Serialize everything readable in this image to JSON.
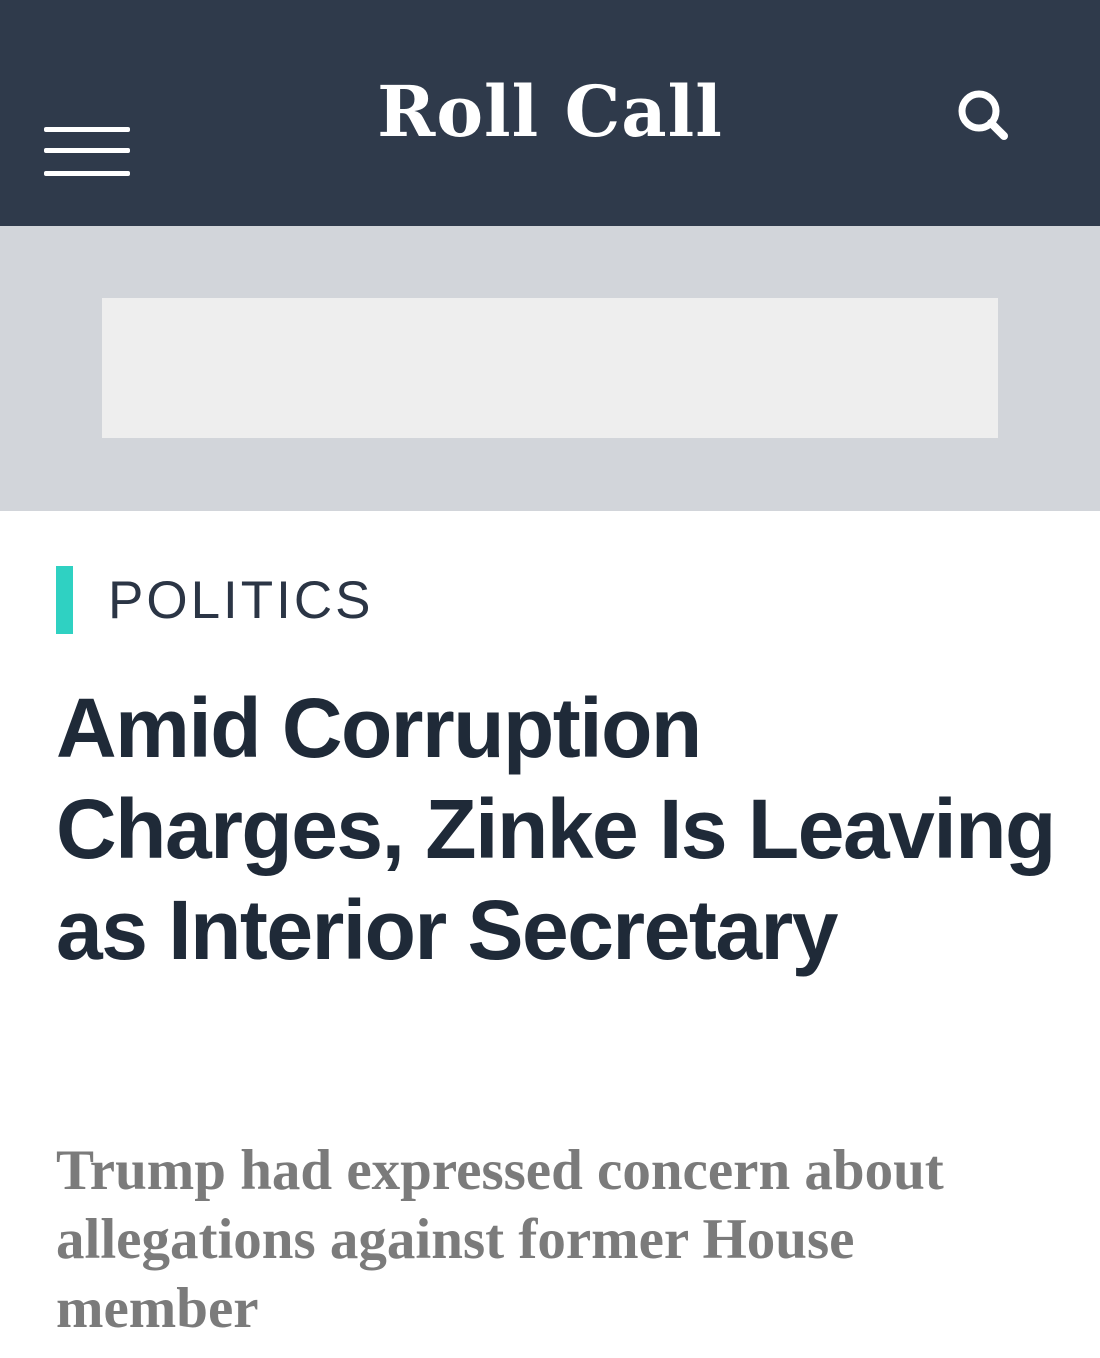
{
  "header": {
    "logo_text": "Roll Call",
    "menu_icon": "hamburger-menu-icon",
    "search_icon": "search-icon",
    "background_color": "#2f3a4b"
  },
  "ad": {
    "band_color": "#d2d5da",
    "slot_color": "#eeeeee"
  },
  "article": {
    "section": "POLITICS",
    "section_accent_color": "#2fd1c2",
    "headline": "Amid Corruption Charges, Zinke Is Leaving as Interior Secretary",
    "dek": "Trump had expressed concern about allegations against former House member"
  }
}
